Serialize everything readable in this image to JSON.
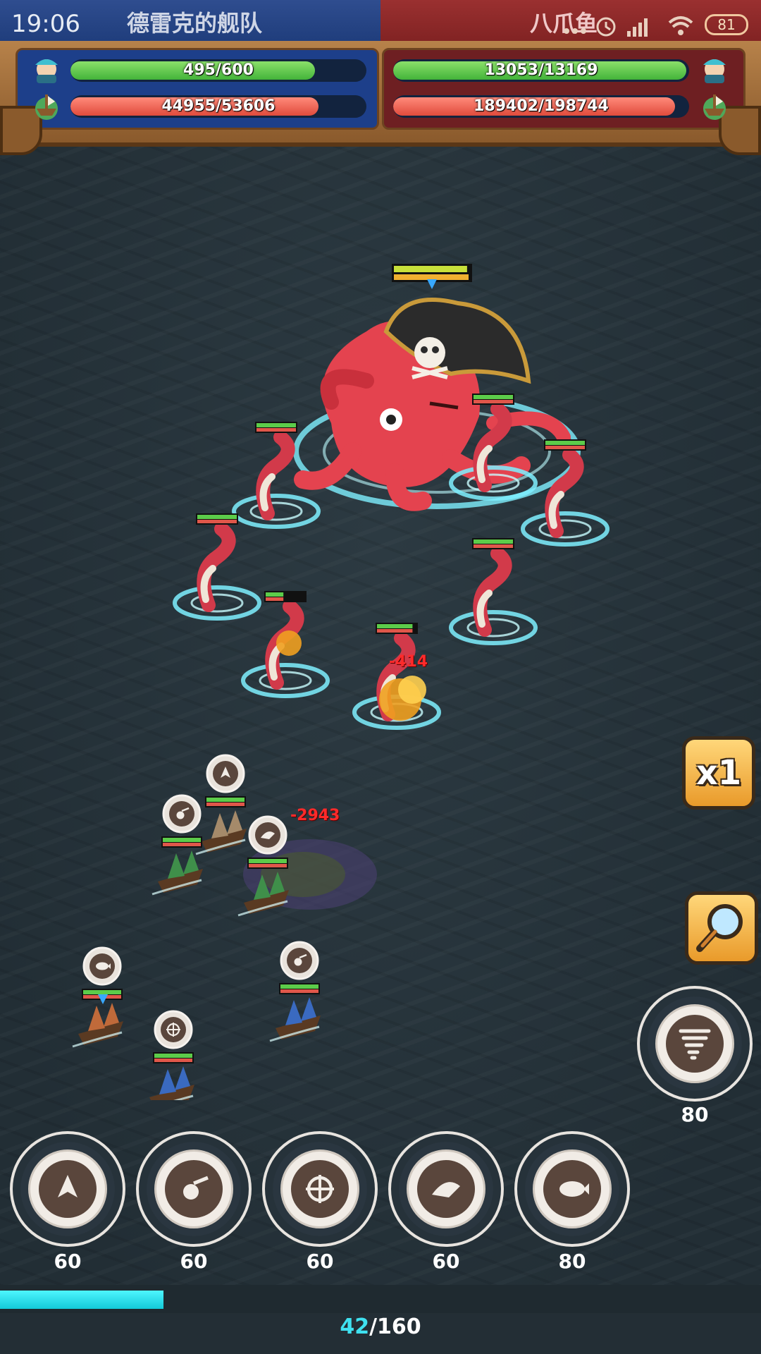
{
  "status_bar": {
    "time": "19:06",
    "battery": "81"
  },
  "hud": {
    "player": {
      "name": "德雷克的舰队",
      "crew_hp": "495/600",
      "crew_fraction": 0.825,
      "ship_hp": "44955/53606",
      "ship_fraction": 0.839,
      "color": "#1d3f8a"
    },
    "enemy": {
      "name": "八爪鱼",
      "crew_hp": "13053/13169",
      "crew_fraction": 0.991,
      "ship_hp": "189402/198744",
      "ship_fraction": 0.953,
      "color": "#6e1f22"
    }
  },
  "battle": {
    "boss": {
      "name": "pirate-octopus",
      "hp_fraction": 0.98
    },
    "damage_numbers": [
      "-414",
      "-2943"
    ],
    "tentacles": [
      {
        "hp_fraction": 1.0
      },
      {
        "hp_fraction": 1.0
      },
      {
        "hp_fraction": 1.0
      },
      {
        "hp_fraction": 1.0
      },
      {
        "hp_fraction": 1.0
      },
      {
        "hp_fraction": 0.45
      },
      {
        "hp_fraction": 0.9
      }
    ],
    "ships": [
      {
        "icon": "flame-crest-icon",
        "hp_fraction": 1.0
      },
      {
        "icon": "cannonball-icon",
        "hp_fraction": 1.0
      },
      {
        "icon": "shark-icon",
        "hp_fraction": 1.0
      },
      {
        "icon": "whale-icon",
        "hp_fraction": 1.0
      },
      {
        "icon": "cannonball-icon",
        "hp_fraction": 1.0
      },
      {
        "icon": "crosshair-icon",
        "hp_fraction": 1.0
      }
    ]
  },
  "controls": {
    "speed_label": "x1",
    "tornado_cost": "80",
    "skills": [
      {
        "icon": "flame-crest-icon",
        "cost": "60"
      },
      {
        "icon": "cannonball-icon",
        "cost": "60"
      },
      {
        "icon": "crosshair-icon",
        "cost": "60"
      },
      {
        "icon": "shark-icon",
        "cost": "60"
      },
      {
        "icon": "whale-icon",
        "cost": "80"
      }
    ]
  },
  "energy": {
    "current": "42",
    "max": "/160",
    "fraction": 0.2625
  }
}
